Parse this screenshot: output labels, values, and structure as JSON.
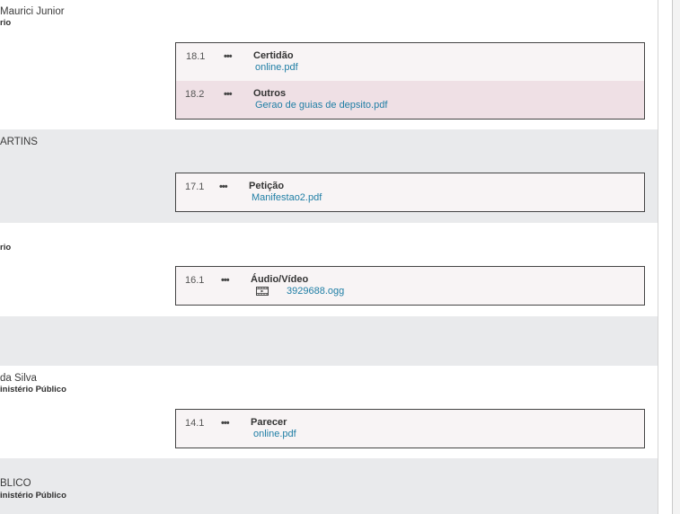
{
  "entries": [
    {
      "person": "Maurici Junior",
      "role": "rio",
      "documents": [
        {
          "number": "18.1",
          "type": "Certidão",
          "file": "online.pdf"
        },
        {
          "number": "18.2",
          "type": "Outros",
          "file": "Gerao de guias de depsito.pdf"
        }
      ]
    },
    {
      "person": "ARTINS",
      "documents": [
        {
          "number": "17.1",
          "type": "Petição",
          "file": "Manifestao2.pdf"
        }
      ]
    },
    {
      "role": "rio",
      "documents": [
        {
          "number": "16.1",
          "type": "Áudio/Vídeo",
          "file": "3929688.ogg",
          "icon": "film-icon"
        }
      ]
    },
    {
      "person": "da Silva",
      "role": "inistério Público",
      "documents": [
        {
          "number": "14.1",
          "type": "Parecer",
          "file": "online.pdf"
        }
      ]
    },
    {
      "person": "BLICO",
      "role": "inistério Público"
    }
  ],
  "icons": {
    "more": "more-dots-icon",
    "media": "film-icon"
  },
  "colors": {
    "link": "#1f7ea5",
    "stripe": "#e9eaec",
    "row_alt": "#efe0e5",
    "box_bg": "#f8f4f5"
  }
}
